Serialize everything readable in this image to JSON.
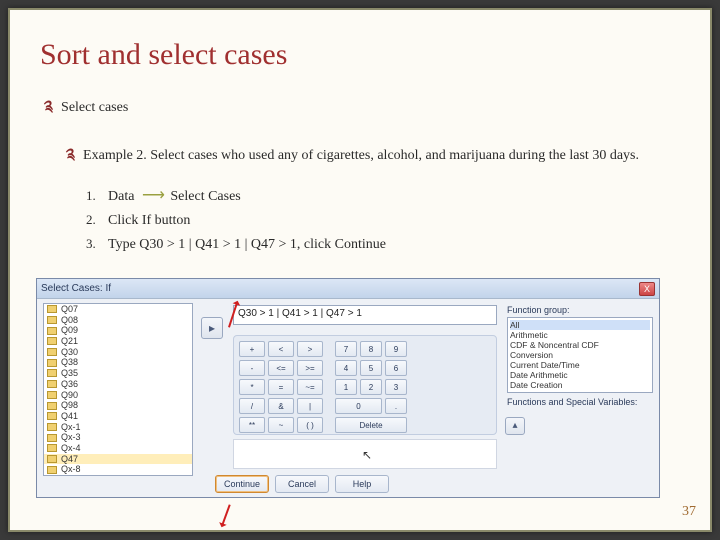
{
  "title": "Sort and select cases",
  "bullet1": "Select cases",
  "bullet2": "Example 2. Select cases who used any of cigarettes, alcohol, and marijuana during the last 30 days.",
  "step1_num": "1.",
  "step1a": "Data",
  "step1b": "Select Cases",
  "step2_num": "2.",
  "step2": "Click If button",
  "step3_num": "3.",
  "step3": "Type Q30  > 1 | Q41 > 1 | Q47 > 1, click Continue",
  "page_num": "37",
  "dialog": {
    "title": "Select Cases: If",
    "close": "X",
    "expression": "Q30 > 1 | Q41 > 1 | Q47 > 1",
    "vars": [
      "Q07",
      "Q08",
      "Q09",
      "Q21",
      "Q30",
      "Q38",
      "Q35",
      "Q36",
      "Q90",
      "Q98",
      "Q41",
      "Qx-1",
      "Qx-3",
      "Qx-4",
      "Q47",
      "Qx-8"
    ],
    "keypad": {
      "r1": [
        "+",
        "<",
        ">",
        "7",
        "8",
        "9"
      ],
      "r2": [
        "-",
        "<=",
        ">=",
        "4",
        "5",
        "6"
      ],
      "r3": [
        "*",
        "=",
        "~=",
        "1",
        "2",
        "3"
      ],
      "r4": [
        "/",
        "&",
        "|",
        "0",
        "."
      ],
      "r5": [
        "**",
        "~",
        "( )"
      ],
      "del": "Delete"
    },
    "func_label": "Function group:",
    "funcs": [
      "All",
      "Arithmetic",
      "CDF & Noncentral CDF",
      "Conversion",
      "Current Date/Time",
      "Date Arithmetic",
      "Date Creation"
    ],
    "func_label2": "Functions and Special Variables:",
    "buttons": {
      "continue": "Continue",
      "cancel": "Cancel",
      "help": "Help"
    }
  }
}
